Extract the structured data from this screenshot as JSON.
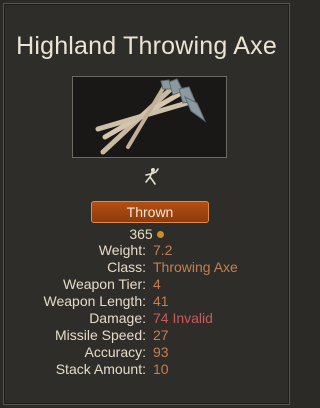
{
  "item": {
    "name": "Highland Throwing Axe",
    "type_label": "Thrown",
    "price": "365"
  },
  "stats": [
    {
      "label": "Weight:",
      "value": "7.2",
      "color": "#c37f52"
    },
    {
      "label": "Class:",
      "value": "Throwing Axe",
      "color": "#c37f52"
    },
    {
      "label": "Weapon Tier:",
      "value": "4",
      "color": "#c37f52"
    },
    {
      "label": "Weapon Length:",
      "value": "41",
      "color": "#c37f52"
    },
    {
      "label": "Damage:",
      "value": "74 Invalid",
      "color": "#c85a5a"
    },
    {
      "label": "Missile Speed:",
      "value": "27",
      "color": "#c37f52"
    },
    {
      "label": "Accuracy:",
      "value": "93",
      "color": "#c37f52"
    },
    {
      "label": "Stack Amount:",
      "value": "10",
      "color": "#c37f52"
    }
  ],
  "icons": {
    "item_image": "throwing-axes-image",
    "usage": "throwing-figure-icon",
    "currency": "gold-coin-icon"
  },
  "colors": {
    "panel_bg": "#2f2d29",
    "title": "#ebe4d4",
    "type_bar": "#a4450f",
    "stat_value": "#c37f52",
    "stat_value_invalid": "#c85a5a"
  }
}
